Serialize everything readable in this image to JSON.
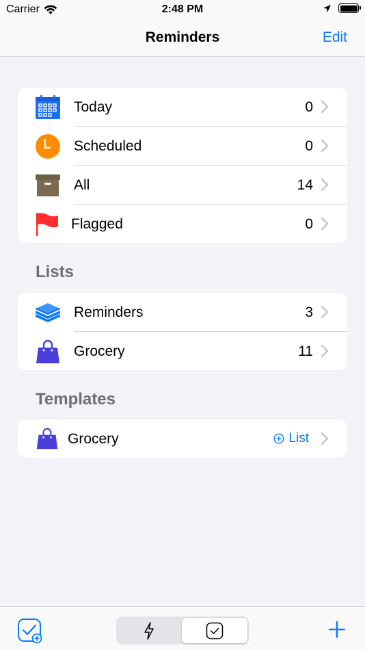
{
  "status": {
    "carrier": "Carrier",
    "time": "2:48 PM"
  },
  "nav": {
    "title": "Reminders",
    "edit": "Edit"
  },
  "smart_lists": [
    {
      "label": "Today",
      "count": "0",
      "icon": "calendar-icon"
    },
    {
      "label": "Scheduled",
      "count": "0",
      "icon": "clock-icon"
    },
    {
      "label": "All",
      "count": "14",
      "icon": "archive-box-icon"
    },
    {
      "label": "Flagged",
      "count": "0",
      "icon": "flag-icon"
    }
  ],
  "lists_section": {
    "title": "Lists"
  },
  "lists": [
    {
      "label": "Reminders",
      "count": "3",
      "icon": "stack-icon"
    },
    {
      "label": "Grocery",
      "count": "11",
      "icon": "shopping-bag-icon"
    }
  ],
  "templates_section": {
    "title": "Templates"
  },
  "templates": [
    {
      "label": "Grocery",
      "action": "List",
      "icon": "shopping-bag-icon"
    }
  ],
  "colors": {
    "accent": "#0a7aff",
    "today": "#1d6ff2",
    "scheduled": "#ff8c00",
    "all": "#7b6a4f",
    "flagged": "#ff2d2d",
    "list_icon": "#4a3fd8"
  }
}
